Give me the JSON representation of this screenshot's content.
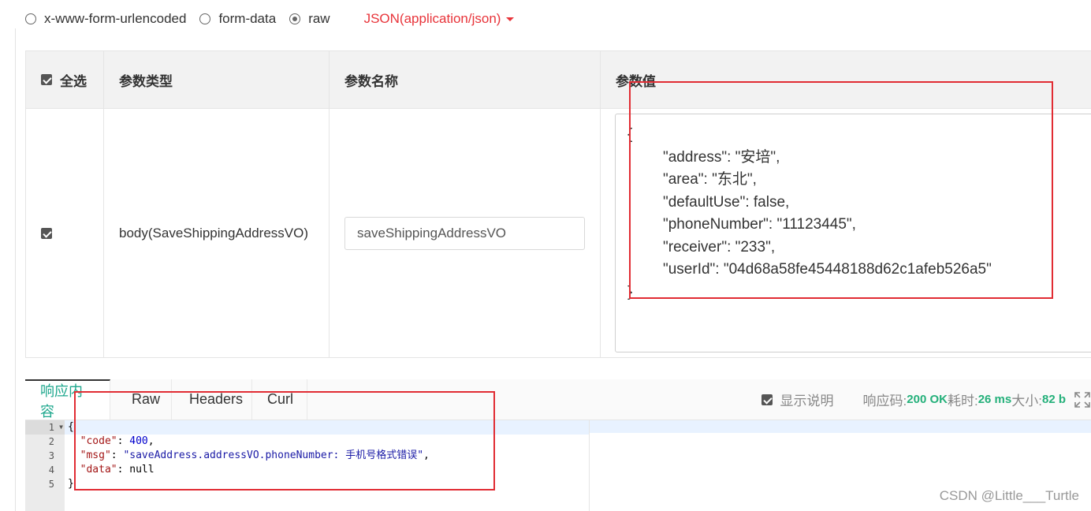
{
  "body_types": {
    "options": [
      "x-www-form-urlencoded",
      "form-data",
      "raw"
    ],
    "selected": "raw",
    "content_type": "JSON(application/json)"
  },
  "param_table": {
    "headers": {
      "select_all": "全选",
      "param_type": "参数类型",
      "param_name": "参数名称",
      "param_value": "参数值"
    },
    "row": {
      "checked": true,
      "param_type": "body(SaveShippingAddressVO)",
      "param_name": "saveShippingAddressVO",
      "json_lines": [
        "{",
        "\"address\": \"安培\",",
        "\"area\": \"东北\",",
        "\"defaultUse\": false,",
        "\"phoneNumber\": \"11123445\",",
        "\"receiver\": \"233\",",
        "\"userId\": \"04d68a58fe45448188d62c1afeb526a5\"",
        "}"
      ]
    }
  },
  "response": {
    "tabs": [
      "响应内容",
      "Raw",
      "Headers",
      "Curl"
    ],
    "active_tab": "响应内容",
    "show_description_label": "显示说明",
    "show_description_checked": true,
    "status_label": "响应码:",
    "status_value": "200 OK",
    "time_label": "耗时:",
    "time_value": "26 ms",
    "size_label": "大小:",
    "size_value": "82 b",
    "line_numbers": [
      "1",
      "2",
      "3",
      "4",
      "5"
    ],
    "code": {
      "open": "{",
      "code_key": "\"code\"",
      "code_val": "400",
      "msg_key": "\"msg\"",
      "msg_val": "\"saveAddress.addressVO.phoneNumber: 手机号格式错误\"",
      "data_key": "\"data\"",
      "data_val": "null",
      "close": "}"
    }
  },
  "watermark": "CSDN @Little___Turtle",
  "colors": {
    "accent_red": "#e8343a",
    "annotation_red": "#e12c33",
    "tab_active_green": "#1ea78d",
    "stat_green": "#24b07a"
  }
}
